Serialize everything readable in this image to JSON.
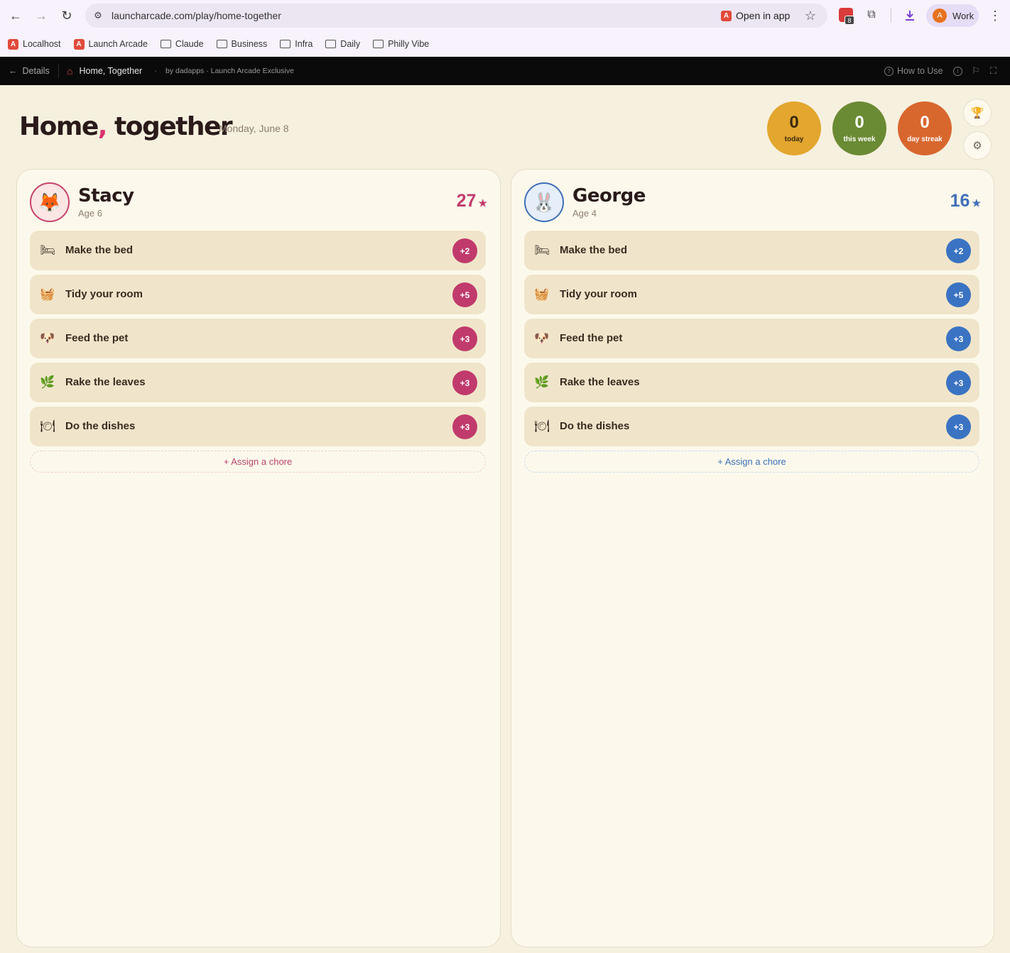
{
  "browser": {
    "url": "launcharcade.com/play/home-together",
    "open_in_app": "Open in app",
    "extension_badge": "8",
    "profile_initial": "A",
    "profile_label": "Work",
    "bookmarks": [
      {
        "label": "Localhost",
        "icon": "launch-arcade-logo"
      },
      {
        "label": "Launch Arcade",
        "icon": "launch-arcade-logo"
      },
      {
        "label": "Claude",
        "icon": "folder-icon"
      },
      {
        "label": "Business",
        "icon": "folder-icon"
      },
      {
        "label": "Infra",
        "icon": "folder-icon"
      },
      {
        "label": "Daily",
        "icon": "folder-icon"
      },
      {
        "label": "Philly Vibe",
        "icon": "folder-icon"
      }
    ]
  },
  "appbar": {
    "back_label": "Details",
    "game_title": "Home, Together",
    "separator": "·",
    "byline": "by dadapps · Launch Arcade Exclusive",
    "how_to_use": "How to Use"
  },
  "header": {
    "title_part1": "Home",
    "title_comma": ",",
    "title_part2": " together",
    "date": "Monday, June 8"
  },
  "stats": {
    "today": {
      "value": "0",
      "label": "today",
      "color": "#e3a62e"
    },
    "week": {
      "value": "0",
      "label": "this week",
      "color": "#6a8a33"
    },
    "streak": {
      "value": "0",
      "label": "day streak",
      "color": "#d8672e"
    }
  },
  "kids": [
    {
      "name": "Stacy",
      "age": "Age 6",
      "points": "27",
      "star": "★",
      "avatar": "fox-icon",
      "accent": "#c13a6c",
      "chores": [
        {
          "label": "Make the bed",
          "points": "+2",
          "icon": "bed-icon"
        },
        {
          "label": "Tidy your room",
          "points": "+5",
          "icon": "basket-icon"
        },
        {
          "label": "Feed the pet",
          "points": "+3",
          "icon": "dog-icon"
        },
        {
          "label": "Rake the leaves",
          "points": "+3",
          "icon": "leaf-icon"
        },
        {
          "label": "Do the dishes",
          "points": "+3",
          "icon": "plate-icon"
        }
      ],
      "assign_label": "+ Assign a chore"
    },
    {
      "name": "George",
      "age": "Age 4",
      "points": "16",
      "star": "★",
      "avatar": "bunny-icon",
      "accent": "#3a73c2",
      "chores": [
        {
          "label": "Make the bed",
          "points": "+2",
          "icon": "bed-icon"
        },
        {
          "label": "Tidy your room",
          "points": "+5",
          "icon": "basket-icon"
        },
        {
          "label": "Feed the pet",
          "points": "+3",
          "icon": "dog-icon"
        },
        {
          "label": "Rake the leaves",
          "points": "+3",
          "icon": "leaf-icon"
        },
        {
          "label": "Do the dishes",
          "points": "+3",
          "icon": "plate-icon"
        }
      ],
      "assign_label": "+ Assign a chore"
    }
  ]
}
